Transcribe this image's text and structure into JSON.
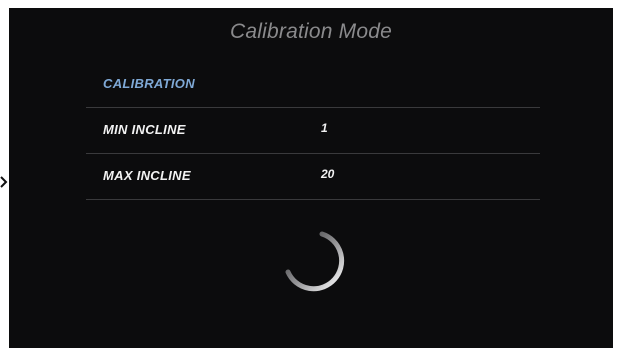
{
  "screen": {
    "title": "Calibration Mode"
  },
  "calibration_table": {
    "header": "CALIBRATION",
    "rows": [
      {
        "label": "MIN INCLINE",
        "value": "1"
      },
      {
        "label": "MAX INCLINE",
        "value": "20"
      }
    ]
  },
  "status": {
    "loading_indicator": "spinner-icon"
  },
  "colors": {
    "background": "#0c0c0d",
    "accent": "#7fa9d6",
    "text": "#f2f2f2",
    "title": "#8a8a8c",
    "divider": "#3a3a3c"
  }
}
